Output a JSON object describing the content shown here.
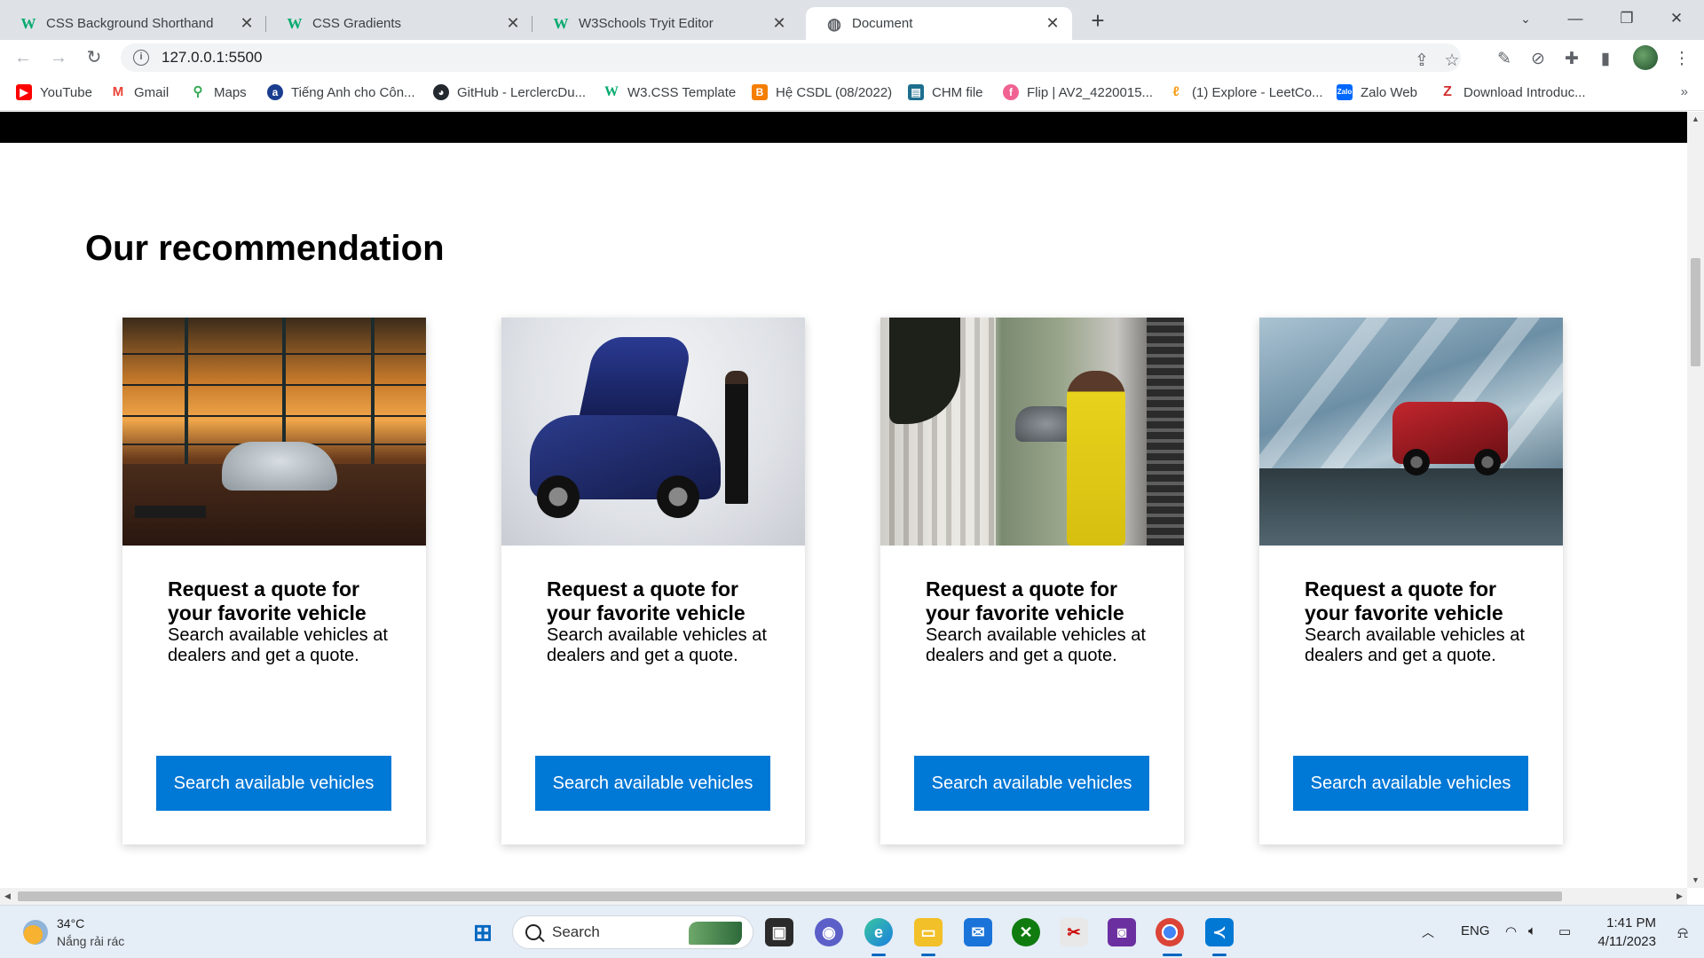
{
  "browser": {
    "tabs": [
      {
        "title": "CSS Background Shorthand",
        "favicon": "w3schools-icon",
        "active": false
      },
      {
        "title": "CSS Gradients",
        "favicon": "w3schools-icon",
        "active": false
      },
      {
        "title": "W3Schools Tryit Editor",
        "favicon": "w3schools-icon",
        "active": false
      },
      {
        "title": "Document",
        "favicon": "globe-icon",
        "active": true
      }
    ],
    "url": "127.0.0.1:5500",
    "bookmarks": [
      {
        "label": "YouTube",
        "color": "#ff0000"
      },
      {
        "label": "Gmail",
        "color": "#ea4335"
      },
      {
        "label": "Maps",
        "color": "#34a853"
      },
      {
        "label": "Tiếng Anh cho Côn...",
        "color": "#1a3d8f"
      },
      {
        "label": "GitHub - LerclercDu...",
        "color": "#24292f"
      },
      {
        "label": "W3.CSS Template",
        "color": "#04aa6d"
      },
      {
        "label": "Hệ CSDL (08/2022)",
        "color": "#f57d00"
      },
      {
        "label": "CHM file",
        "color": "#1e6f8e"
      },
      {
        "label": "Flip | AV2_4220015...",
        "color": "#f06292"
      },
      {
        "label": "(1) Explore - LeetCo...",
        "color": "#f89f1b"
      },
      {
        "label": "Zalo Web",
        "color": "#0068ff"
      },
      {
        "label": "Download Introduc...",
        "color": "#d32f2f"
      }
    ],
    "bookmarks_more": "»"
  },
  "page": {
    "heading": "Our recommendation",
    "cards": [
      {
        "title": "Request a quote for your favorite vehicle",
        "description": "Search available vehicles at dealers and get a quote.",
        "button": "Search available vehicles"
      },
      {
        "title": "Request a quote for your favorite vehicle",
        "description": "Search available vehicles at dealers and get a quote.",
        "button": "Search available vehicles"
      },
      {
        "title": "Request a quote for your favorite vehicle",
        "description": "Search available vehicles at dealers and get a quote.",
        "button": "Search available vehicles"
      },
      {
        "title": "Request a quote for your favorite vehicle",
        "description": "Search available vehicles at dealers and get a quote.",
        "button": "Search available vehicles"
      }
    ],
    "button_color": "#0078d6"
  },
  "taskbar": {
    "weather_temp": "34°C",
    "weather_desc": "Nắng rải rác",
    "search_label": "Search",
    "language": "ENG",
    "time": "1:41 PM",
    "date": "4/11/2023"
  }
}
